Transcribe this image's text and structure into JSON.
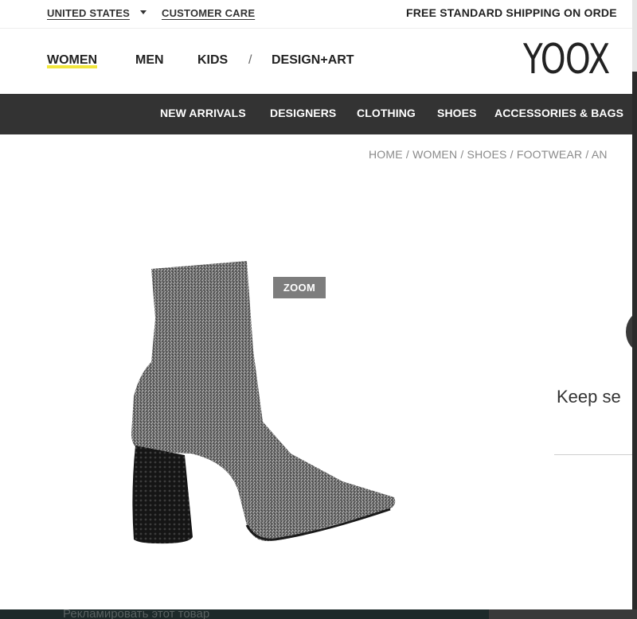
{
  "utility": {
    "country": "UNITED STATES",
    "customer_care": "CUSTOMER CARE",
    "shipping": "FREE STANDARD SHIPPING ON ORDE"
  },
  "header": {
    "nav": {
      "women": "WOMEN",
      "men": "MEN",
      "kids": "KIDS",
      "separator": "/",
      "design_art": "DESIGN+ART"
    },
    "logo": "YOOX"
  },
  "categories": [
    "NEW ARRIVALS",
    "DESIGNERS",
    "CLOTHING",
    "SHOES",
    "ACCESSORIES & BAGS"
  ],
  "breadcrumb": "HOME / WOMEN / SHOES / FOOTWEAR / AN",
  "product": {
    "zoom_label": "ZOOM"
  },
  "side_panel": {
    "keep_text": "Keep se"
  },
  "footer": {
    "ad_link": "Рекламировать этот товар"
  },
  "colors": {
    "category_bar": "#333333",
    "nav_underline": "#f1e63c",
    "zoom_badge": "#7d7d7d"
  }
}
